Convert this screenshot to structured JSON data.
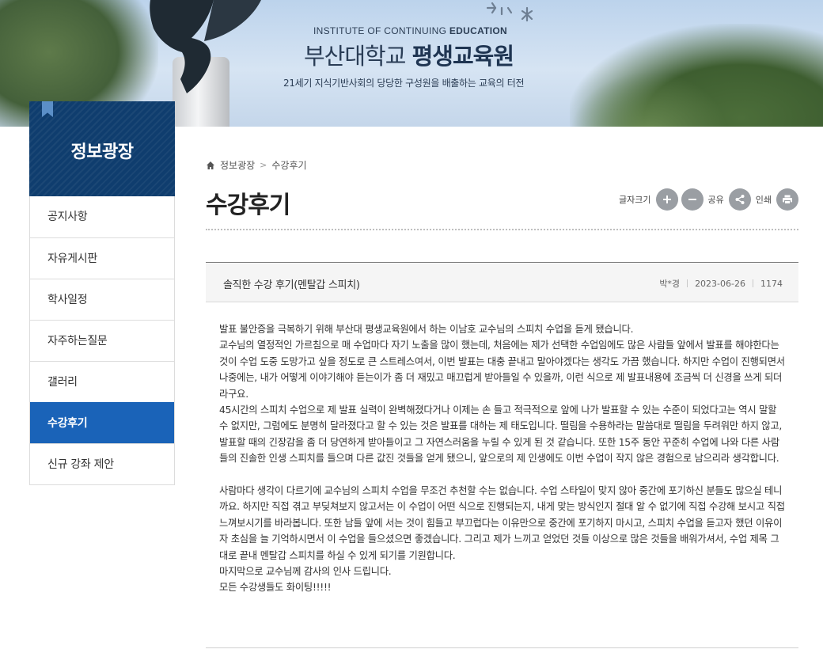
{
  "banner": {
    "institute_en_regular": "INSTITUTE OF CONTINUING ",
    "institute_en_bold": "EDUCATION",
    "name_regular": "부산대학교 ",
    "name_bold": "평생교육원",
    "slogan": "21세기 지식기반사회의 당당한 구성원을 배출하는 교육의 터전"
  },
  "sidebar": {
    "title": "정보광장",
    "items": [
      {
        "label": "공지사항",
        "active": false
      },
      {
        "label": "자유게시판",
        "active": false
      },
      {
        "label": "학사일정",
        "active": false
      },
      {
        "label": "자주하는질문",
        "active": false
      },
      {
        "label": "갤러리",
        "active": false
      },
      {
        "label": "수강후기",
        "active": true
      },
      {
        "label": "신규 강좌 제안",
        "active": false
      }
    ]
  },
  "breadcrumb": {
    "home_icon": "home-icon",
    "items": [
      "정보광장",
      "수강후기"
    ],
    "separator": ">"
  },
  "page": {
    "title": "수강후기"
  },
  "tools": {
    "font_size_label": "글자크기",
    "share_label": "공유",
    "print_label": "인쇄"
  },
  "post": {
    "title": "솔직한 수강 후기(멘탈갑 스피치)",
    "author": "박*경",
    "date": "2023-06-26",
    "views": "1174",
    "paragraphs": [
      "발표 불안증을 극복하기 위해 부산대 평생교육원에서 하는 이남호 교수님의 스피치 수업을 듣게 됐습니다.",
      "교수님의 열정적인 가르침으로 매 수업마다 자기 노출을 많이 했는데, 처음에는 제가 선택한 수업임에도 많은 사람들 앞에서 발표를 해야한다는 것이 수업 도중 도망가고 싶을 정도로 큰 스트레스여서, 이번 발표는 대충 끝내고 말아야겠다는 생각도 가끔 했습니다. 하지만 수업이 진행되면서 나중에는, 내가 어떻게 이야기해야 듣는이가 좀 더 재밌고 매끄럽게 받아들일 수 있을까, 이런 식으로 제 발표내용에 조금씩 더 신경을 쓰게 되더라구요.",
      "45시간의 스피치 수업으로 제 발표 실력이 완벽해졌다거나 이제는 손 들고 적극적으로 앞에 나가 발표할 수 있는 수준이 되었다고는 역시 말할 수 없지만, 그럼에도 분명히 달라졌다고 할 수 있는 것은 발표를 대하는 제 태도입니다. 떨림을 수용하라는 말씀대로 떨림을 두려워만 하지 않고, 발표할 때의 긴장감을 좀 더 당연하게 받아들이고 그 자연스러움을 누릴 수 있게 된 것 같습니다. 또한 15주 동안 꾸준히 수업에 나와 다른 사람들의 진솔한 인생 스피치를 들으며 다른 값진 것들을 얻게 됐으니, 앞으로의 제 인생에도 이번 수업이 작지 않은 경험으로 남으리라 생각합니다.",
      "",
      " 사람마다 생각이 다르기에 교수님의 스피치 수업을 무조건 추천할 수는 없습니다. 수업 스타일이 맞지 않아 중간에 포기하신 분들도 많으실 테니까요. 하지만 직접 겪고 부딪쳐보지 않고서는 이 수업이 어떤 식으로 진행되는지, 내게 맞는 방식인지 절대 알 수 없기에 직접 수강해 보시고 직접 느껴보시기를 바라봅니다. 또한 남들 앞에 서는 것이 힘들고 부끄럽다는 이유만으로 중간에 포기하지 마시고, 스피치 수업을 듣고자 했던 이유이자 초심을 늘 기억하시면서 이 수업을 들으셨으면 좋겠습니다. 그리고 제가 느끼고 얻었던 것들 이상으로 많은 것들을 배워가셔서, 수업 제목 그대로 끝내 멘탈갑 스피치를 하실 수 있게 되기를 기원합니다.",
      "마지막으로 교수님께 감사의 인사 드립니다.",
      "모든 수강생들도 화이팅!!!!!"
    ]
  }
}
